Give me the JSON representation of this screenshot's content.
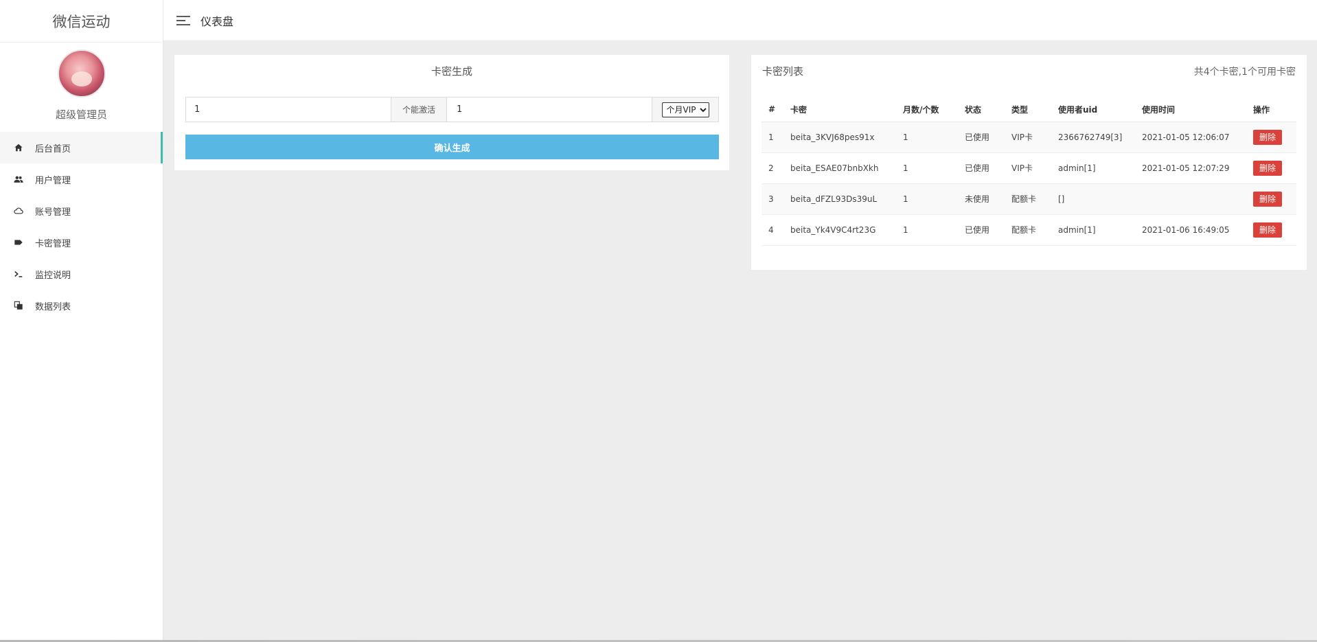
{
  "sidebar": {
    "brand": "微信运动",
    "profile_name": "超级管理员",
    "items": [
      {
        "label": "后台首页",
        "icon": "home-icon"
      },
      {
        "label": "用户管理",
        "icon": "users-icon"
      },
      {
        "label": "账号管理",
        "icon": "cloud-icon"
      },
      {
        "label": "卡密管理",
        "icon": "tag-icon"
      },
      {
        "label": "监控说明",
        "icon": "terminal-icon"
      },
      {
        "label": "数据列表",
        "icon": "copy-icon"
      }
    ]
  },
  "header": {
    "title": "仪表盘"
  },
  "generator": {
    "title": "卡密生成",
    "count_value": "1",
    "addon_label": "个能激活",
    "months_value": "1",
    "type_selected": "个月VIP",
    "confirm_label": "确认生成"
  },
  "card_list": {
    "title": "卡密列表",
    "summary": "共4个卡密,1个可用卡密",
    "columns": [
      "#",
      "卡密",
      "月数/个数",
      "状态",
      "类型",
      "使用者uid",
      "使用时间",
      "操作"
    ],
    "rows": [
      {
        "id": "1",
        "code": "beita_3KVJ68pes91x",
        "months": "1",
        "status": "已使用",
        "type": "VIP卡",
        "user": "2366762749[3]",
        "time": "2021-01-05 12:06:07",
        "action": "删除"
      },
      {
        "id": "2",
        "code": "beita_ESAE07bnbXkh",
        "months": "1",
        "status": "已使用",
        "type": "VIP卡",
        "user": "admin[1]",
        "time": "2021-01-05 12:07:29",
        "action": "删除"
      },
      {
        "id": "3",
        "code": "beita_dFZL93Ds39uL",
        "months": "1",
        "status": "未使用",
        "type": "配额卡",
        "user": "[]",
        "time": "",
        "action": "删除"
      },
      {
        "id": "4",
        "code": "beita_Yk4V9C4rt23G",
        "months": "1",
        "status": "已使用",
        "type": "配额卡",
        "user": "admin[1]",
        "time": "2021-01-06 16:49:05",
        "action": "删除"
      }
    ]
  },
  "colors": {
    "accent": "#3bbdb0",
    "primary_button": "#58b7e3",
    "danger_button": "#d9413a"
  }
}
